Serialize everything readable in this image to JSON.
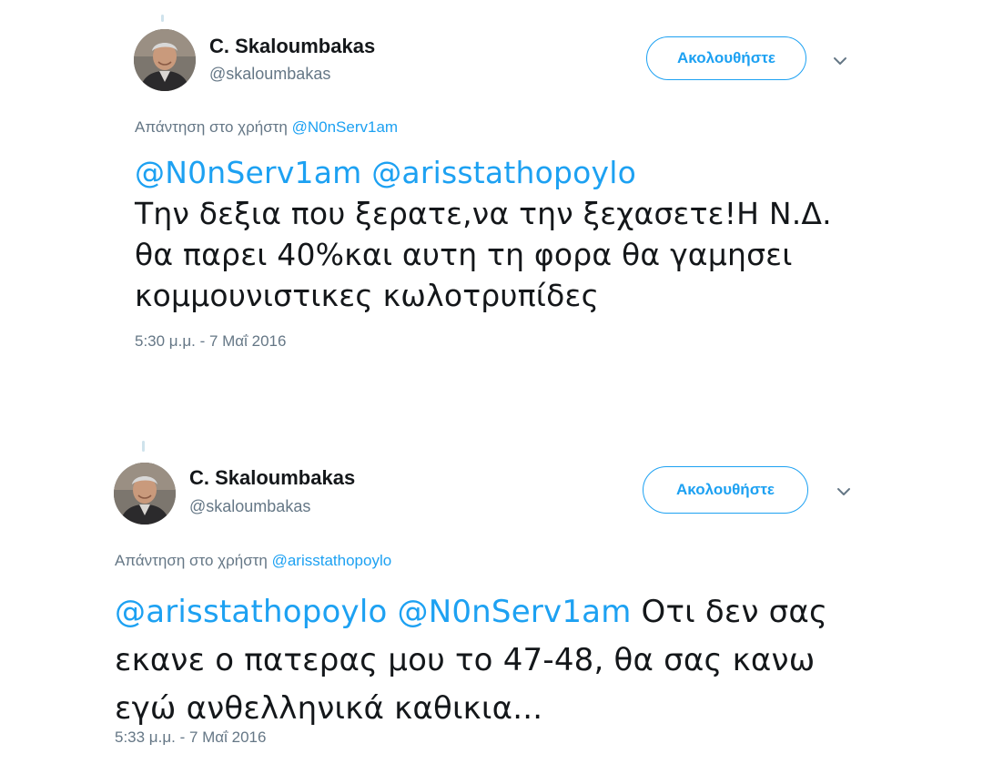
{
  "tweets": [
    {
      "author": {
        "name": "C. Skaloumbakas",
        "handle": "@skaloumbakas"
      },
      "follow_label": "Ακολουθήστε",
      "reply_prefix": "Απάντηση στο χρήστη",
      "reply_mention": "@N0nServ1am",
      "mentions": [
        "@N0nServ1am",
        "@arisstathopoylo"
      ],
      "text_line1_rest": "",
      "text_lines": [
        "Την δεξια που ξερατε,να την ξεχασετε!Η Ν.Δ.",
        "θα παρει 40%και αυτη τη φορα θα γαμησει",
        "κομμουνιστικες κωλοτρυπίδες"
      ],
      "timestamp": "5:30 μ.μ. - 7 Μαΐ 2016"
    },
    {
      "author": {
        "name": "C. Skaloumbakas",
        "handle": "@skaloumbakas"
      },
      "follow_label": "Ακολουθήστε",
      "reply_prefix": "Απάντηση στο χρήστη",
      "reply_mention": "@arisstathopoylo",
      "mentions": [
        "@arisstathopoylo",
        "@N0nServ1am"
      ],
      "text_line1_rest": "Οτι δεν σας",
      "text_lines": [
        "εκανε ο πατερας μου το 47-48, θα σας κανω",
        "εγώ ανθελληνικά καθικια..."
      ],
      "timestamp": "5:33 μ.μ. - 7 Μαΐ 2016"
    }
  ],
  "icons": {
    "avatar": "avatar-photo",
    "menu": "chevron-down-icon"
  },
  "colors": {
    "accent": "#1da1f2",
    "muted": "#657786",
    "text": "#14171a",
    "thread_line": "#cfe3ec"
  }
}
